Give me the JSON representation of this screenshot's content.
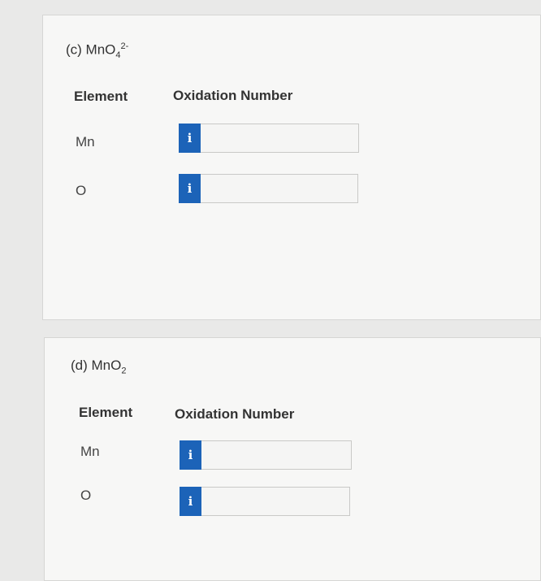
{
  "part_c": {
    "title_prefix": "(c) MnO",
    "title_sub": "4",
    "title_sup": "2-",
    "header_element": "Element",
    "header_oxidation": "Oxidation Number",
    "rows": [
      {
        "element": "Mn",
        "info": "i",
        "value": ""
      },
      {
        "element": "O",
        "info": "i",
        "value": ""
      }
    ]
  },
  "part_d": {
    "title_prefix": "(d) MnO",
    "title_sub": "2",
    "header_element": "Element",
    "header_oxidation": "Oxidation Number",
    "rows": [
      {
        "element": "Mn",
        "info": "i",
        "value": ""
      },
      {
        "element": "O",
        "info": "i",
        "value": ""
      }
    ]
  },
  "colors": {
    "info_button": "#1c63b8",
    "panel": "#f7f7f6",
    "background": "#e9e9e8"
  }
}
